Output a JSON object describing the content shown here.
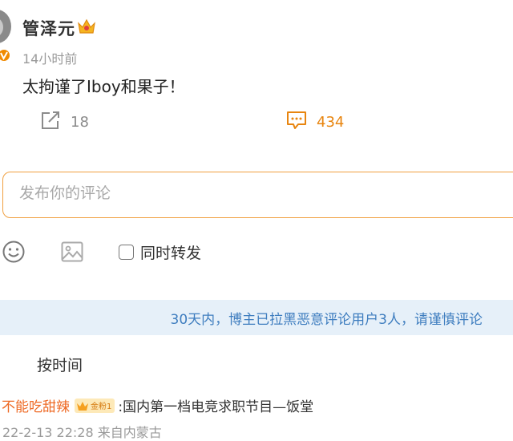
{
  "post": {
    "username": "管泽元",
    "timestamp": "14小时前",
    "text": "太拘谨了Iboy和果子！",
    "share_count": "18",
    "comment_count": "434"
  },
  "composer": {
    "placeholder": "发布你的评论",
    "repost_label": "同时转发"
  },
  "notice": "30天内，博主已拉黑恶意评论用户3人，请谨慎评论",
  "sort_label": "按时间",
  "comments": [
    {
      "user": "不能吃甜辣",
      "fan_badge": "金粉1",
      "text": ":国内第一档电竞求职节目—饭堂",
      "meta": "22-2-13 22:28 来自内蒙古"
    }
  ],
  "colors": {
    "accent": "#e8850f",
    "notice_bg": "#e6f0f9",
    "notice_text": "#3e7dbf",
    "comment_user": "#ee6a25"
  },
  "icons": [
    "crown-icon",
    "verified-icon",
    "share-icon",
    "comment-icon",
    "emoji-icon",
    "image-icon"
  ]
}
